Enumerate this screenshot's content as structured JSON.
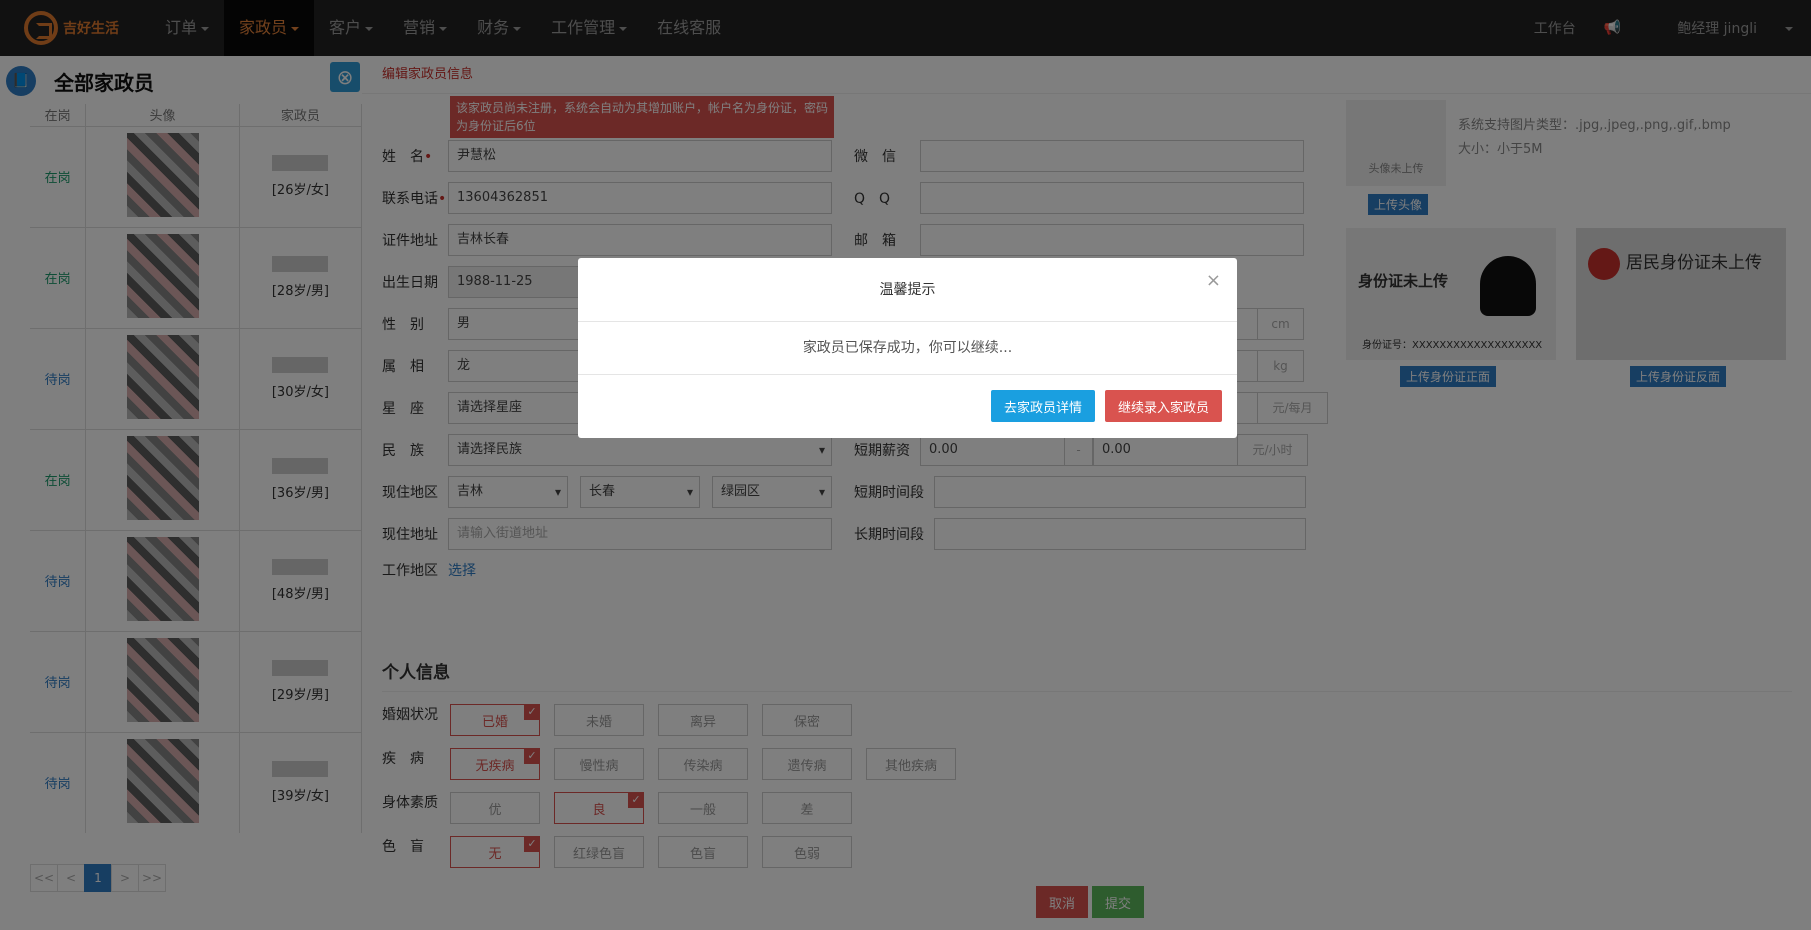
{
  "brand": {
    "name": "吉好生活"
  },
  "nav": [
    "订单",
    "家政员",
    "客户",
    "营销",
    "财务",
    "工作管理",
    "在线客服"
  ],
  "topright": {
    "workbench": "工作台",
    "user": "鲍经理 jingli"
  },
  "left": {
    "title": "全部家政员",
    "headers": [
      "在岗",
      "头像",
      "家政员"
    ],
    "rows": [
      {
        "status": "在岗",
        "info": "[26岁/女]"
      },
      {
        "status": "在岗",
        "info": "[28岁/男]"
      },
      {
        "status": "待岗",
        "info": "[30岁/女]"
      },
      {
        "status": "在岗",
        "info": "[36岁/男]"
      },
      {
        "status": "待岗",
        "info": "[48岁/男]"
      },
      {
        "status": "待岗",
        "info": "[29岁/男]"
      },
      {
        "status": "待岗",
        "info": "[39岁/女]"
      }
    ],
    "pager": [
      "<<",
      "<",
      "1",
      ">",
      ">>"
    ]
  },
  "form": {
    "header": "编辑家政员信息",
    "warn": "该家政员尚未注册，系统会自动为其增加账户，帐户名为身份证，密码为身份证后6位",
    "name_label": "姓　名",
    "name": "尹慧松",
    "phone_label": "联系电话",
    "phone": "13604362851",
    "idaddr_label": "证件地址",
    "idaddr": "吉林长春",
    "birth_label": "出生日期",
    "birth": "1988-11-25",
    "sex_label": "性　别",
    "sex": "男",
    "zodiac_label": "属　相",
    "zodiac": "龙",
    "star_label": "星　座",
    "star": "请选择星座",
    "nation_label": "民　族",
    "nation": "请选择民族",
    "region_label": "现住地区",
    "province": "吉林",
    "city": "长春",
    "district": "绿园区",
    "addr_label": "现住地址",
    "addr_ph": "请输入街道地址",
    "work_label": "工作地区",
    "work_link": "选择",
    "wechat_label": "微　信",
    "qq_label": "Q　Q",
    "email_label": "邮　箱",
    "unit_cm": "cm",
    "unit_kg": "kg",
    "unit_month": "元/每月",
    "short_label": "短期薪资",
    "short_from": "0.00",
    "short_to": "0.00",
    "unit_hour": "元/小时",
    "dash": "-",
    "short_time_label": "短期时间段",
    "long_time_label": "长期时间段"
  },
  "photo": {
    "avatar_text": "头像未上传",
    "types": "系统支持图片类型：.jpg,.jpeg,.png,.gif,.bmp",
    "size": "大小：小于5M",
    "upload_avatar": "上传头像",
    "id_front": "身份证未上传",
    "id_no": "身份证号：XXXXXXXXXXXXXXXXXXX",
    "id_back": "居民身份证未上传",
    "upload_front": "上传身份证正面",
    "upload_back": "上传身份证反面"
  },
  "personal": {
    "title": "个人信息",
    "marriage_label": "婚姻状况",
    "marriage": [
      "已婚",
      "未婚",
      "离异",
      "保密"
    ],
    "disease_label": "疾　病",
    "disease": [
      "无疾病",
      "慢性病",
      "传染病",
      "遗传病",
      "其他疾病"
    ],
    "body_label": "身体素质",
    "body": [
      "优",
      "良",
      "一般",
      "差"
    ],
    "color_label": "色　盲",
    "color": [
      "无",
      "红绿色盲",
      "色盲",
      "色弱"
    ],
    "cancel": "取消",
    "submit": "提交"
  },
  "modal": {
    "title": "温馨提示",
    "message": "家政员已保存成功，你可以继续...",
    "btn_detail": "去家政员详情",
    "btn_continue": "继续录入家政员",
    "close": "×"
  }
}
